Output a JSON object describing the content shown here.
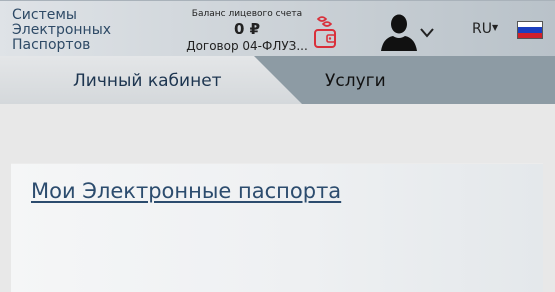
{
  "header": {
    "logo_lines": [
      "Системы",
      "Электронных",
      "Паспортов"
    ],
    "balance_label": "Баланс лицевого счета",
    "balance_amount": "0 ₽",
    "contract": "Договор 04-ФЛУЗ...",
    "wallet_icon": "wallet-icon",
    "user_icon": "user-avatar-icon",
    "language": "RU",
    "flag_colors": [
      "#ffffff",
      "#1c3fbf",
      "#d0202a"
    ]
  },
  "tabs": [
    {
      "label": "Личный кабинет",
      "active": true
    },
    {
      "label": "Услуги",
      "active": false
    }
  ],
  "main": {
    "card_title": "Мои Электронные паспорта"
  },
  "colors": {
    "accent": "#2c4c6e",
    "wallet": "#d9303a"
  }
}
